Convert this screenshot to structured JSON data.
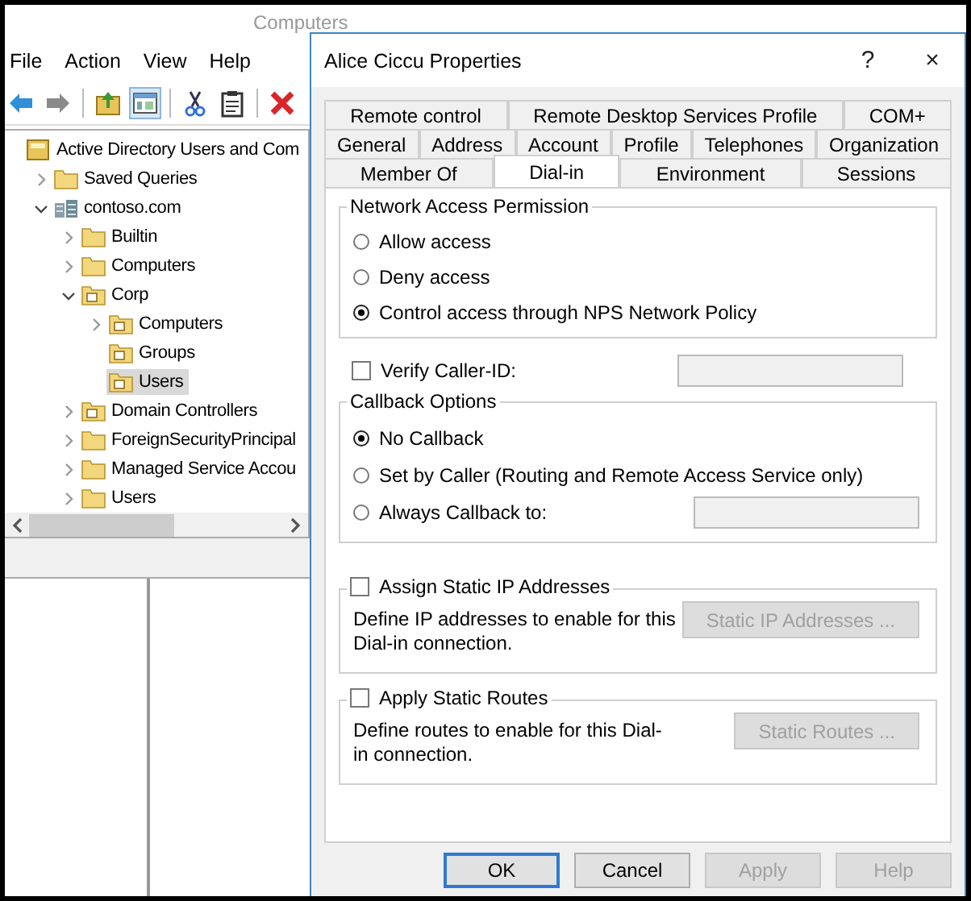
{
  "console": {
    "title": "Computers",
    "menu": [
      "File",
      "Action",
      "View",
      "Help"
    ],
    "toolbar": [
      {
        "kind": "back",
        "pressed": false
      },
      {
        "kind": "forward",
        "pressed": false
      },
      {
        "kind": "up",
        "pressed": false
      },
      {
        "kind": "tree",
        "pressed": true
      },
      {
        "kind": "cut",
        "pressed": false
      },
      {
        "kind": "paste",
        "pressed": false
      },
      {
        "kind": "delete",
        "pressed": false
      }
    ],
    "tree": [
      {
        "label": "Active Directory Users and Com",
        "kind": "root",
        "selected": false,
        "children": [
          {
            "label": "Saved Queries",
            "kind": "folder",
            "selected": false,
            "expanded": false
          },
          {
            "label": "contoso.com",
            "kind": "domain",
            "selected": false,
            "expanded": true,
            "children": [
              {
                "label": "Builtin",
                "kind": "folder",
                "selected": false,
                "expanded": false
              },
              {
                "label": "Computers",
                "kind": "folder",
                "selected": false,
                "expanded": false
              },
              {
                "label": "Corp",
                "kind": "ou",
                "selected": false,
                "expanded": true,
                "children": [
                  {
                    "label": "Computers",
                    "kind": "ou",
                    "selected": false,
                    "expanded": false
                  },
                  {
                    "label": "Groups",
                    "kind": "ou",
                    "selected": false
                  },
                  {
                    "label": "Users",
                    "kind": "ou",
                    "selected": true
                  }
                ]
              },
              {
                "label": "Domain Controllers",
                "kind": "ou",
                "selected": false,
                "expanded": false
              },
              {
                "label": "ForeignSecurityPrincipal",
                "kind": "folder",
                "selected": false,
                "expanded": false
              },
              {
                "label": "Managed Service Accou",
                "kind": "folder",
                "selected": false,
                "expanded": false
              },
              {
                "label": "Users",
                "kind": "folder",
                "selected": false,
                "expanded": false
              }
            ]
          }
        ]
      }
    ]
  },
  "dialog": {
    "title": "Alice Ciccu Properties",
    "help": "?",
    "close": "×",
    "tab_rows": [
      [
        {
          "label": "Remote control",
          "selected": false
        },
        {
          "label": "Remote Desktop Services Profile",
          "selected": false
        },
        {
          "label": "COM+",
          "selected": false
        }
      ],
      [
        {
          "label": "General",
          "selected": false
        },
        {
          "label": "Address",
          "selected": false
        },
        {
          "label": "Account",
          "selected": false
        },
        {
          "label": "Profile",
          "selected": false
        },
        {
          "label": "Telephones",
          "selected": false
        },
        {
          "label": "Organization",
          "selected": false
        }
      ],
      [
        {
          "label": "Member Of",
          "selected": false
        },
        {
          "label": "Dial-in",
          "selected": true
        },
        {
          "label": "Environment",
          "selected": false
        },
        {
          "label": "Sessions",
          "selected": false
        }
      ]
    ],
    "network_access": {
      "title": "Network Access Permission",
      "options": [
        {
          "label": "Allow access",
          "selected": false
        },
        {
          "label": "Deny access",
          "selected": false
        },
        {
          "label": "Control access through NPS Network Policy",
          "selected": true
        }
      ]
    },
    "verify_caller_id": {
      "label": "Verify Caller-ID:",
      "checked": false
    },
    "callback": {
      "title": "Callback Options",
      "options": [
        {
          "label": "No Callback",
          "selected": true,
          "field": false
        },
        {
          "label": "Set by Caller (Routing and Remote Access Service only)",
          "selected": false,
          "field": false
        },
        {
          "label": "Always Callback to:",
          "selected": false,
          "field": true
        }
      ]
    },
    "static_ip": {
      "label": "Assign Static IP Addresses",
      "checked": false,
      "description": "Define IP addresses to enable for this Dial-in connection.",
      "button": {
        "label": "Static IP Addresses ...",
        "disabled": true
      }
    },
    "static_routes": {
      "label": "Apply Static Routes",
      "checked": false,
      "description": "Define routes to enable for this Dial-in connection.",
      "button": {
        "label": "Static Routes ...",
        "disabled": true
      }
    },
    "buttons": [
      {
        "label": "OK",
        "default": true,
        "disabled": false
      },
      {
        "label": "Cancel",
        "default": false,
        "disabled": false
      },
      {
        "label": "Apply",
        "default": false,
        "disabled": true
      },
      {
        "label": "Help",
        "default": false,
        "disabled": true
      }
    ]
  }
}
